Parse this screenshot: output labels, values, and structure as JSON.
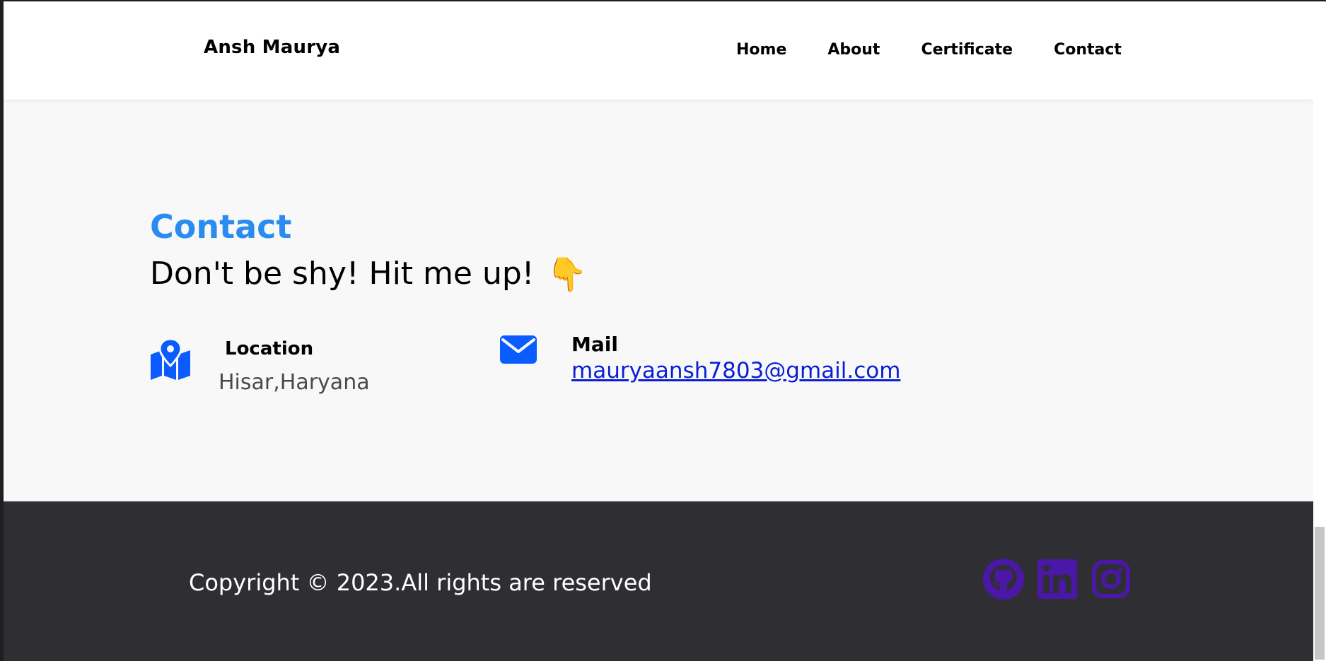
{
  "navbar": {
    "brand": "Ansh Maurya",
    "links": [
      "Home",
      "About",
      "Certificate",
      "Contact"
    ]
  },
  "contact": {
    "heading": "Contact",
    "subheading": "Don't be shy! Hit me up!",
    "emoji": "👇",
    "location": {
      "icon": "map-location-icon",
      "title": "Location",
      "value": "Hisar,Haryana"
    },
    "mail": {
      "icon": "envelope-icon",
      "title": "Mail",
      "value": "mauryaansh7803@gmail.com"
    }
  },
  "footer": {
    "copyright": "Copyright © 2023.All rights are reserved",
    "socials": [
      "github-icon",
      "linkedin-icon",
      "instagram-icon"
    ]
  },
  "colors": {
    "accent": "#2a8cf0",
    "icon_blue": "#0b5cff",
    "social_purple": "#4b17a6",
    "footer_bg": "#2f2f33",
    "link": "#0a1fd4"
  }
}
